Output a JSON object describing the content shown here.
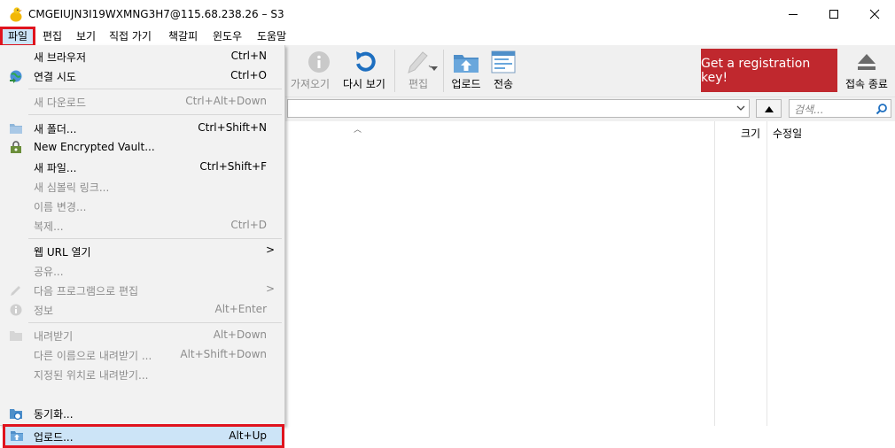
{
  "window": {
    "title": "CMGEIUJN3I19WXMNG3H7@115.68.238.26 – S3"
  },
  "menubar": {
    "items": [
      "파일",
      "편집",
      "보기",
      "직접 가기",
      "책갈피",
      "윈도우",
      "도움말"
    ]
  },
  "toolbar": {
    "info_label": "가져오기",
    "refresh_label": "다시 보기",
    "edit_label": "편집",
    "upload_label": "업로드",
    "transfer_label": "전송",
    "registration_label": "Get a registration key!",
    "disconnect_label": "접속 종료"
  },
  "pathbar": {
    "search_placeholder": "검색..."
  },
  "browser": {
    "columns": [
      "크기",
      "수정일"
    ]
  },
  "file_menu": {
    "items": [
      {
        "label": "새 브라우저",
        "shortcut": "Ctrl+N",
        "disabled": false
      },
      {
        "label": "연결 시도",
        "shortcut": "Ctrl+O",
        "disabled": false
      },
      {
        "label": "새 다운로드",
        "shortcut": "Ctrl+Alt+Down",
        "disabled": true
      },
      {
        "label": "새 폴더...",
        "shortcut": "Ctrl+Shift+N",
        "disabled": false
      },
      {
        "label": "New Encrypted Vault...",
        "shortcut": "",
        "disabled": false
      },
      {
        "label": "새 파일...",
        "shortcut": "Ctrl+Shift+F",
        "disabled": false
      },
      {
        "label": "새 심볼릭 링크...",
        "shortcut": "",
        "disabled": true
      },
      {
        "label": "이름 변경...",
        "shortcut": "",
        "disabled": true
      },
      {
        "label": "복제...",
        "shortcut": "Ctrl+D",
        "disabled": true
      },
      {
        "label": "웹 URL 열기",
        "shortcut": "",
        "disabled": false,
        "submenu": ">"
      },
      {
        "label": "공유...",
        "shortcut": "",
        "disabled": true
      },
      {
        "label": "다음 프로그램으로 편집",
        "shortcut": "",
        "disabled": true,
        "submenu": ">"
      },
      {
        "label": "정보",
        "shortcut": "Alt+Enter",
        "disabled": true
      },
      {
        "label": "내려받기",
        "shortcut": "Alt+Down",
        "disabled": true
      },
      {
        "label": "다른 이름으로 내려받기 ...",
        "shortcut": "Alt+Shift+Down",
        "disabled": true
      },
      {
        "label": "지정된 위치로 내려받기...",
        "shortcut": "",
        "disabled": true
      },
      {
        "label": "업로드...",
        "shortcut": "Alt+Up",
        "disabled": false
      },
      {
        "label": "동기화...",
        "shortcut": "",
        "disabled": false
      }
    ]
  },
  "colors": {
    "highlight_outline": "#e0141e",
    "registration_bg": "#c0282e",
    "menu_hover": "#cce4f7"
  }
}
